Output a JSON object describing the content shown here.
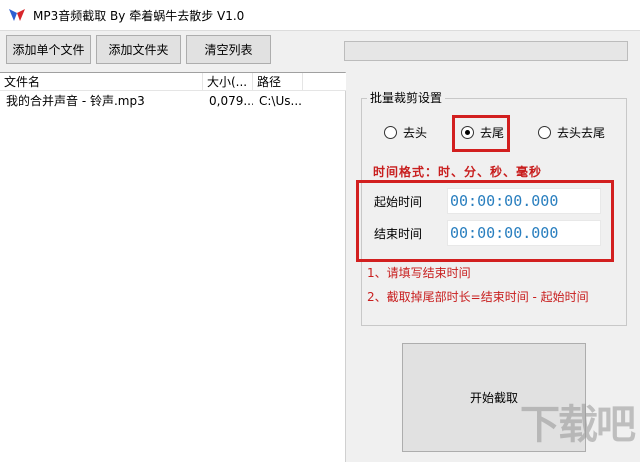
{
  "window": {
    "title": "MP3音频截取 By 牵着蜗牛去散步 V1.0"
  },
  "toolbar": {
    "add_file": "添加单个文件",
    "add_folder": "添加文件夹",
    "clear_list": "清空列表"
  },
  "list": {
    "columns": [
      "文件名",
      "大小(...",
      "路径"
    ],
    "rows": [
      {
        "name": "我的合并声音 - 铃声.mp3",
        "size": "0,079...",
        "path": "C:\\Us..."
      }
    ]
  },
  "batch": {
    "title": "批量裁剪设置",
    "options": [
      "去头",
      "去尾",
      "去头去尾"
    ],
    "selected": "去尾",
    "time_format": "时间格式：时、分、秒、毫秒",
    "start_label": "起始时间",
    "start_value": "00:00:00.000",
    "end_label": "结束时间",
    "end_value": "00:00:00.000",
    "note1": "1、请填写结束时间",
    "note2": "2、截取掉尾部时长=结束时间 - 起始时间"
  },
  "start_button": "开始截取",
  "watermark": "下载吧",
  "colors": {
    "accent_red": "#d21f1f",
    "time_blue": "#2a7fbf"
  }
}
